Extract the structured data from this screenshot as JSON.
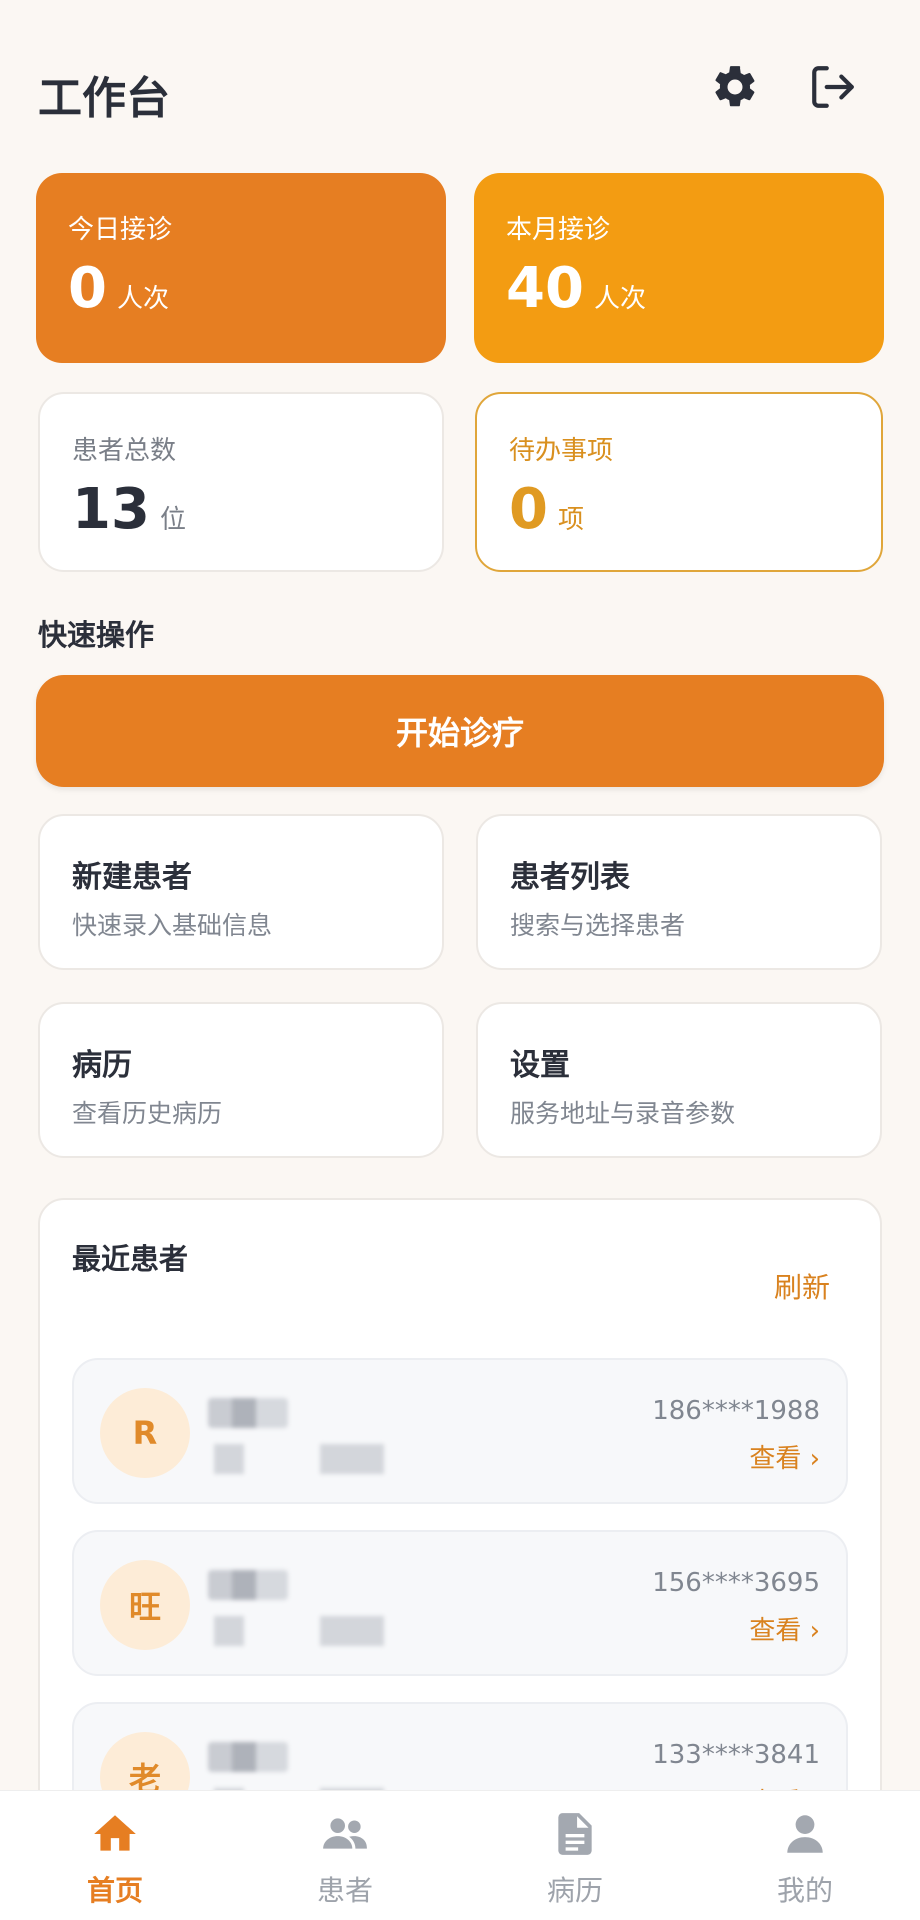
{
  "header": {
    "title": "工作台",
    "settings_icon": "gear-icon",
    "logout_icon": "logout-icon"
  },
  "stats": {
    "today": {
      "label": "今日接诊",
      "value": "0",
      "unit": "人次"
    },
    "month": {
      "label": "本月接诊",
      "value": "40",
      "unit": "人次"
    },
    "patients": {
      "label": "患者总数",
      "value": "13",
      "unit": "位"
    },
    "todo": {
      "label": "待办事项",
      "value": "0",
      "unit": "项"
    }
  },
  "quick": {
    "title": "快速操作",
    "start_label": "开始诊疗",
    "cards": [
      {
        "title": "新建患者",
        "subtitle": "快速录入基础信息"
      },
      {
        "title": "患者列表",
        "subtitle": "搜索与选择患者"
      },
      {
        "title": "病历",
        "subtitle": "查看历史病历"
      },
      {
        "title": "设置",
        "subtitle": "服务地址与录音参数"
      }
    ]
  },
  "recent": {
    "title": "最近患者",
    "refresh_label": "刷新",
    "patients": [
      {
        "avatar": "R",
        "phone": "186****1988",
        "view_label": "查看 ›"
      },
      {
        "avatar": "旺",
        "phone": "156****3695",
        "view_label": "查看 ›"
      },
      {
        "avatar": "老",
        "phone": "133****3841",
        "view_label": "查看 ›"
      }
    ]
  },
  "tabs": [
    {
      "label": "首页",
      "icon": "home-icon",
      "active": true
    },
    {
      "label": "患者",
      "icon": "users-icon",
      "active": false
    },
    {
      "label": "病历",
      "icon": "document-icon",
      "active": false
    },
    {
      "label": "我的",
      "icon": "user-icon",
      "active": false
    }
  ],
  "colors": {
    "accent": "#e67e22",
    "accent_light": "#f39c12",
    "text": "#2b2f3a"
  }
}
